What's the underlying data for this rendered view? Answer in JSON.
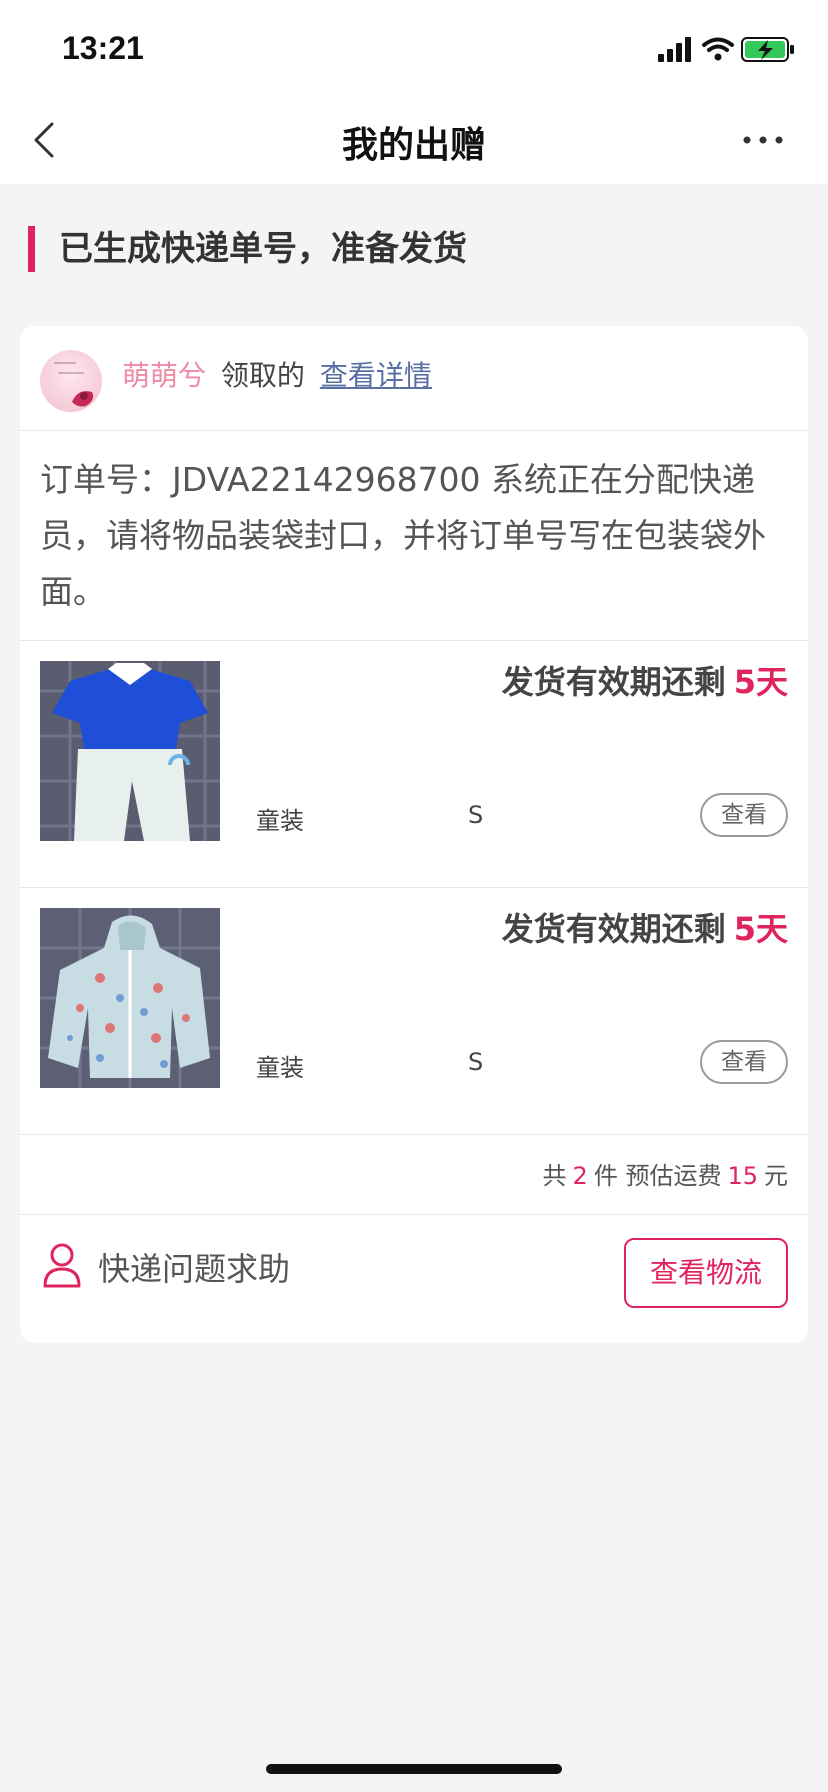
{
  "status_bar": {
    "time": "13:21"
  },
  "nav": {
    "title": "我的出赠"
  },
  "section": {
    "heading": "已生成快递单号，准备发货"
  },
  "receiver": {
    "name": "萌萌兮",
    "action": "领取的",
    "link": "查看详情"
  },
  "order": {
    "message": "订单号：JDVA22142968700 系统正在分配快递员，请将物品装袋封口，并将订单号写在包装袋外面。"
  },
  "items": [
    {
      "deadline_label": "发货有效期还剩",
      "deadline_days": "5天",
      "category": "童装",
      "size": "S",
      "view_label": "查看"
    },
    {
      "deadline_label": "发货有效期还剩",
      "deadline_days": "5天",
      "category": "童装",
      "size": "S",
      "view_label": "查看"
    }
  ],
  "summary": {
    "prefix": "共",
    "count": "2",
    "count_unit": "件",
    "shipping_label": "预估运费",
    "shipping_fee": "15",
    "currency": "元"
  },
  "help": {
    "label": "快递问题求助",
    "logistics_button": "查看物流"
  },
  "colors": {
    "accent": "#e0245e",
    "receiver_name": "#f08aa6",
    "link": "#5a6fa3",
    "background": "#f4f4f5"
  }
}
